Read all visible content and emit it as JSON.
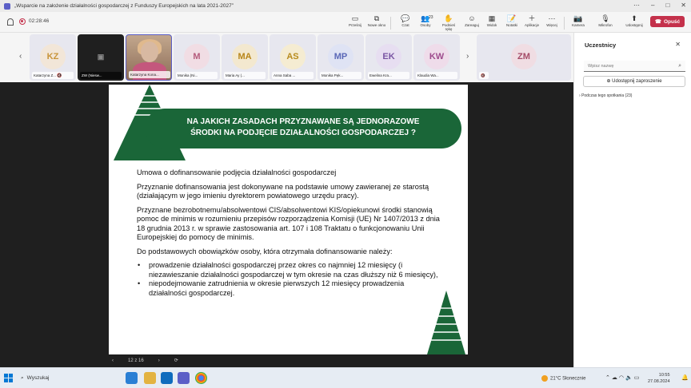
{
  "window": {
    "title": "„Wsparcie na założenie działalności gospodarczej z Funduszy Europejskich na lata 2021-2027”"
  },
  "toolbar": {
    "timer": "02:28:46",
    "buttons": [
      {
        "label": "Prześnij",
        "icon": "▭"
      },
      {
        "label": "Nowe okno",
        "icon": "⧉"
      },
      {
        "label": "Czat",
        "icon": "💬"
      },
      {
        "label": "Osoby",
        "icon": "👥"
      },
      {
        "label": "Podnieś rękę",
        "icon": "✋"
      },
      {
        "label": "Zareaguj",
        "icon": "☺"
      },
      {
        "label": "Widok",
        "icon": "▦"
      },
      {
        "label": "Notatki",
        "icon": "📝"
      },
      {
        "label": "Aplikacje",
        "icon": "＋"
      },
      {
        "label": "Więcej",
        "icon": "⋯"
      },
      {
        "label": "Kamera",
        "icon": "📷"
      },
      {
        "label": "Mikrofon",
        "icon": "🎙"
      },
      {
        "label": "Udostępnij",
        "icon": "⬆"
      }
    ],
    "people_count": "23",
    "leave_label": "Opuść"
  },
  "participants": [
    {
      "initials": "KZ",
      "name": "Katarzyna Z...",
      "color": "#c8943a",
      "bg": "#f2e6d8"
    },
    {
      "initials": "",
      "name": "ZW (Niesw...",
      "color": "#fff",
      "bg": "#1f1f1f"
    },
    {
      "initials": "",
      "name": "Katarzyna Kona...",
      "color": "#fff",
      "bg": "#b08a70"
    },
    {
      "initials": "M",
      "name": "Monika (Ni...",
      "color": "#b55b7c",
      "bg": "#f1dde4"
    },
    {
      "initials": "MA",
      "name": "Maria Ay (...",
      "color": "#b8861a",
      "bg": "#f3e8cf"
    },
    {
      "initials": "AS",
      "name": "Anna Saba ...",
      "color": "#b88b1d",
      "bg": "#f5ecd2"
    },
    {
      "initials": "MP",
      "name": "Monika Pęk...",
      "color": "#5a67b7",
      "bg": "#dfe3f4"
    },
    {
      "initials": "EK",
      "name": "Ewelina Kra...",
      "color": "#7a55a3",
      "bg": "#e7def1"
    },
    {
      "initials": "KW",
      "name": "Klaudia Wa...",
      "color": "#9e4b8d",
      "bg": "#efdcea"
    },
    {
      "initials": "ZM",
      "name": "",
      "color": "#a54c68",
      "bg": "#f0dde3"
    }
  ],
  "slide": {
    "title_line1": "NA JAKICH ZASADACH PRZYZNAWANE SĄ JEDNORAZOWE",
    "title_line2": "ŚRODKI NA PODJĘCIE DZIAŁALNOŚCI GOSPODARCZEJ ?",
    "p1": "Umowa o dofinansowanie podjęcia działalności gospodarczej",
    "p2": "Przyznanie dofinansowania jest dokonywane na podstawie umowy zawieranej ze starostą (działającym w jego imieniu dyrektorem powiatowego urzędu pracy).",
    "p3": "Przyznane bezrobotnemu/absolwentowi CIS/absolwentowi KIS/opiekunowi środki stanowią pomoc de minimis w rozumieniu przepisów rozporządzenia Komisji (UE) Nr 1407/2013 z dnia 18 grudnia 2013 r. w sprawie zastosowania art. 107 i 108 Traktatu o funkcjonowaniu Unii Europejskiej do pomocy de minimis.",
    "p4": "Do podstawowych obowiązków osoby, która otrzymała dofinansowanie należy:",
    "bullet1": "prowadzenie działalności gospodarczej przez okres co najmniej 12 miesięcy (i niezawieszanie działalności gospodarczej w tym okresie na czas dłuższy niż 6 miesięcy),",
    "bullet2": "niepodejmowanie zatrudnienia w okresie pierwszych 12 miesięcy prowadzenia działalności gospodarczej.",
    "page_indicator": "12 z 16"
  },
  "panel": {
    "title": "Uczestnicy",
    "search_placeholder": "Wpisz nazwę",
    "invite_label": "Udostępnij zaproszenie",
    "in_meeting_label": "Podczas tego spotkania (23)"
  },
  "taskbar": {
    "search_label": "Wyszukaj",
    "weather": "21°C  Słonecznie",
    "time": "10:55",
    "date": "27.08.2024"
  }
}
